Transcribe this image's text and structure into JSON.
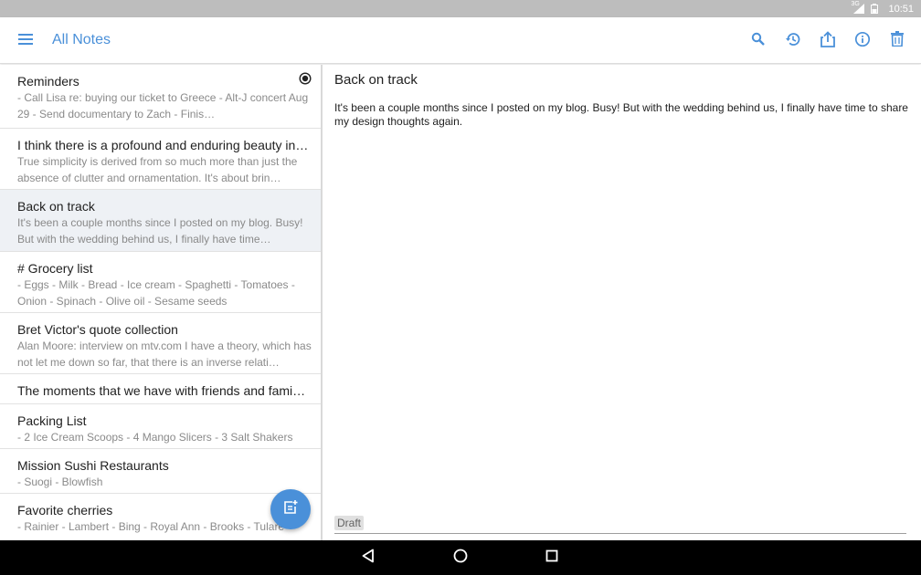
{
  "status_bar": {
    "time": "10:51",
    "network": "3G"
  },
  "app_bar": {
    "title": "All Notes"
  },
  "notes": [
    {
      "title": "Reminders",
      "preview": "- Call Lisa re: buying our ticket to Greece - Alt-J concert Aug 29 - Send documentary to Zach - Finis…",
      "pinned": true
    },
    {
      "title": "I think there is a profound and enduring beauty in…",
      "preview": "True simplicity is derived from so much more than just the absence of clutter and ornamentation. It's about brin…"
    },
    {
      "title": "Back on track",
      "preview": "It's been a couple months since I posted on my blog. Busy! But with the wedding behind us, I finally have time…",
      "selected": true
    },
    {
      "title": "# Grocery list",
      "preview": "- Eggs - Milk - Bread - Ice cream - Spaghetti - Tomatoes - Onion - Spinach - Olive oil - Sesame seeds"
    },
    {
      "title": "Bret Victor's quote collection",
      "preview": "Alan Moore: interview on mtv.com I have a theory, which has not let me down so far, that there is an inverse relati…"
    },
    {
      "title": "The moments that we have with friends and fami…",
      "preview": ""
    },
    {
      "title": "Packing List",
      "preview": "- 2 Ice Cream Scoops - 4 Mango Slicers - 3 Salt Shakers"
    },
    {
      "title": "Mission Sushi Restaurants",
      "preview": "- Suogi - Blowfish"
    },
    {
      "title": "Favorite cherries",
      "preview": "- Rainier - Lambert - Bing - Royal Ann - Brooks - Tulare"
    }
  ],
  "detail": {
    "title": "Back on track",
    "body": "It's been a couple months since I posted on my blog. Busy! But with the wedding behind us, I finally have time to share my design thoughts again.",
    "draft_label": "Draft"
  },
  "colors": {
    "accent": "#4a90d9",
    "selected_row": "#eef1f5",
    "status_bar": "#bdbdbd"
  },
  "icons": [
    "menu-icon",
    "search-icon",
    "history-icon",
    "share-icon",
    "info-icon",
    "trash-icon",
    "pin-icon",
    "new-note-icon",
    "back-icon",
    "home-icon",
    "recents-icon"
  ]
}
